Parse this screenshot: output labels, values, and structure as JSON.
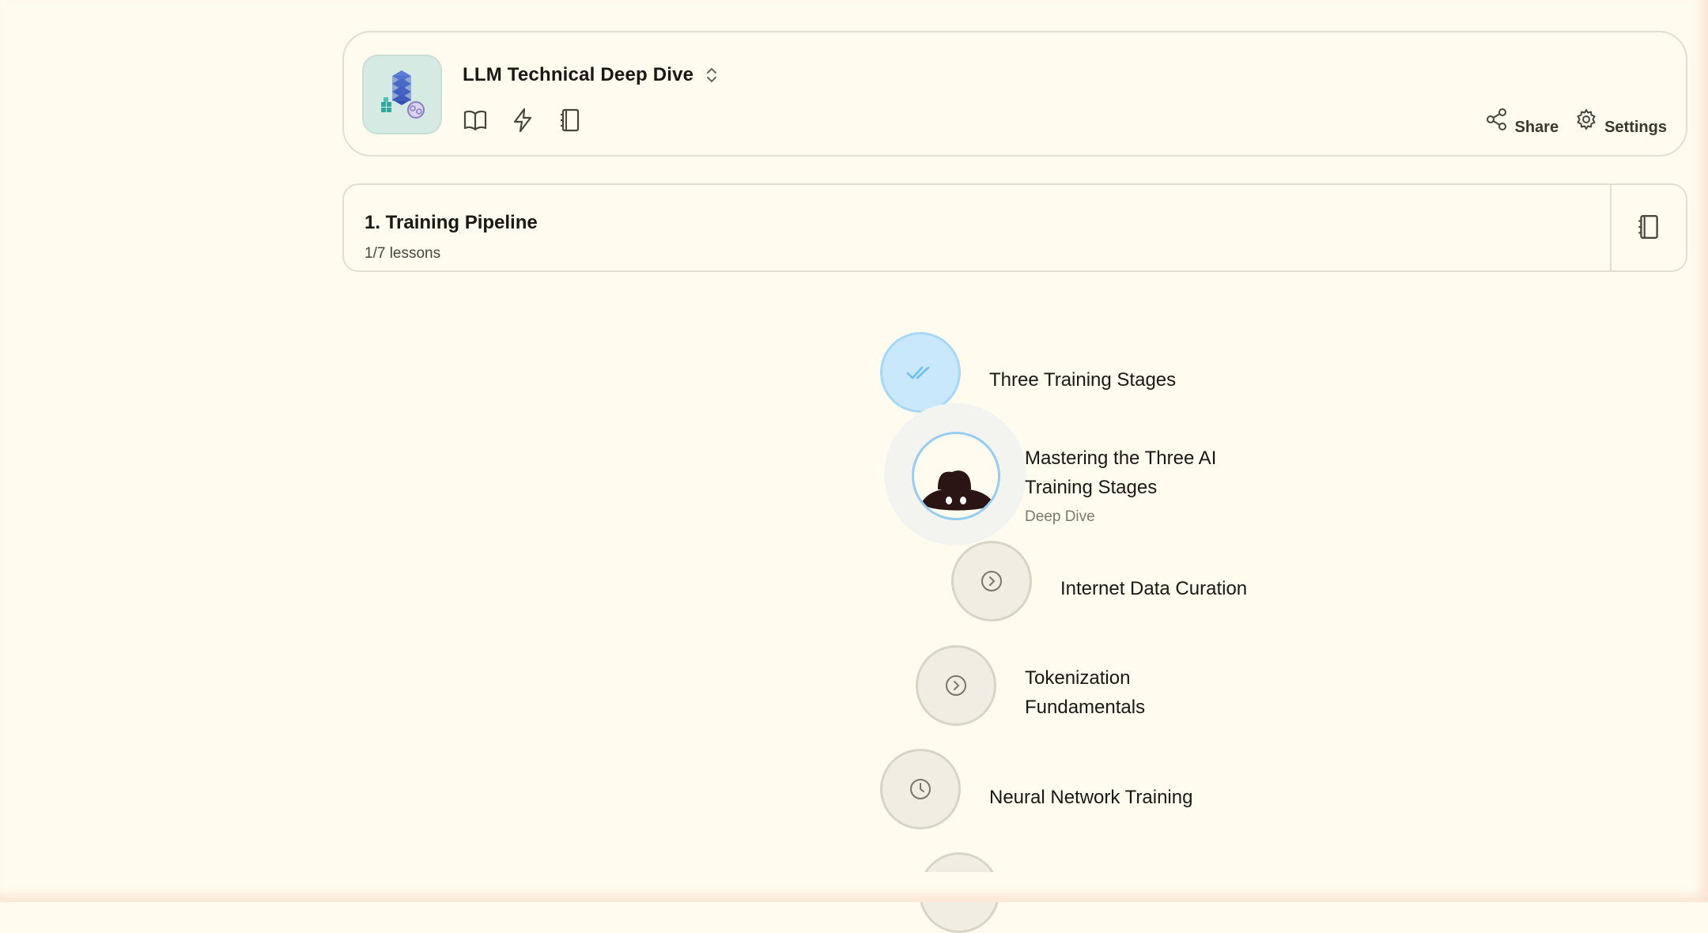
{
  "header": {
    "course_title": "LLM Technical Deep Dive",
    "share_label": "Share",
    "settings_label": "Settings",
    "icons": [
      "book-icon",
      "lightning-icon",
      "notebook-icon"
    ]
  },
  "unit": {
    "title": "1. Training Pipeline",
    "progress": "1/7 lessons"
  },
  "lessons": [
    {
      "label": "Three Training Stages",
      "status": "completed",
      "icon": "double-check-icon"
    },
    {
      "label_line1": "Mastering the Three AI",
      "label_line2": "Training Stages",
      "subtitle": "Deep Dive",
      "status": "current",
      "icon": "hat-avatar"
    },
    {
      "label": "Internet Data Curation",
      "status": "available",
      "icon": "chevron-circle-icon"
    },
    {
      "label_line1": "Tokenization",
      "label_line2": "Fundamentals",
      "status": "available",
      "icon": "chevron-circle-icon"
    },
    {
      "label": "Neural Network Training",
      "status": "locked",
      "icon": "clock-icon"
    }
  ],
  "colors": {
    "background": "#fffcef",
    "completed_fill": "#c9e8fb",
    "completed_check": "#6ec1ea",
    "node_fill": "#f0ede2",
    "avatar_ring": "#96cdf0"
  }
}
